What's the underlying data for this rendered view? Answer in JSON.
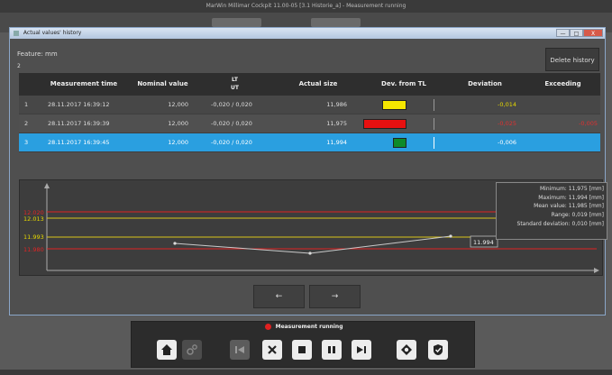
{
  "window": {
    "title": "MarWin Millimar Cockpit 11.00-05   [3.1 Historie_a]   -   Measurement running"
  },
  "dialog": {
    "title": "Actual values' history",
    "controls": {
      "minimize": "—",
      "maximize": "□",
      "close": "X"
    }
  },
  "feature": {
    "label": "Feature: mm",
    "count": "2"
  },
  "delete_button": "Delete history",
  "table": {
    "headers": {
      "index": "",
      "time": "Measurement time",
      "nominal": "Nominal value",
      "lt": "LT",
      "ut": "UT",
      "actual": "Actual size",
      "devtl": "Dev. from TL",
      "deviation": "Deviation",
      "exceeding": "Exceeding"
    },
    "rows": [
      {
        "index": "1",
        "time": "28.11.2017 16:39:12",
        "nominal": "12,000",
        "tol": "-0,020 / 0,020",
        "actual": "11,986",
        "bar_color": "#f5e600",
        "bar_fraction": 0.35,
        "deviation": "-0,014",
        "deviation_color": "#e6d800",
        "exceeding": "",
        "exceeding_color": "#e03030"
      },
      {
        "index": "2",
        "time": "28.11.2017 16:39:39",
        "nominal": "12,000",
        "tol": "-0,020 / 0,020",
        "actual": "11,975",
        "bar_color": "#e81010",
        "bar_fraction": 0.62,
        "deviation": "-0,025",
        "deviation_color": "#e03030",
        "exceeding": "-0,005",
        "exceeding_color": "#e03030"
      },
      {
        "index": "3",
        "time": "28.11.2017 16:39:45",
        "nominal": "12,000",
        "tol": "-0,020 / 0,020",
        "actual": "11,994",
        "bar_color": "#0e8a2a",
        "bar_fraction": 0.19,
        "deviation": "-0,006",
        "deviation_color": "#ffffff",
        "exceeding": "",
        "exceeding_color": "#e03030"
      }
    ],
    "selected_row": 2
  },
  "chart_data": {
    "type": "line",
    "y_labels": {
      "upper_red": "12.020",
      "upper_yellow": "12.013",
      "lower_yellow": "11.993",
      "lower_red": "11.980"
    },
    "values": [
      11.986,
      11.975,
      11.994
    ],
    "last_value_label": "11.994",
    "colors": {
      "red": "#e02424",
      "yellow": "#d9c51a",
      "line": "#c9c9c9"
    }
  },
  "stats": {
    "minimum": "Minimum: 11,975 [mm]",
    "maximum": "Maximum: 11,994 [mm]",
    "mean": "Mean value: 11,985 [mm]",
    "range": "Range: 0,019 [mm]",
    "std": "Standard deviation: 0,010 [mm]"
  },
  "nav": {
    "prev": "←",
    "next": "→"
  },
  "toolbar": {
    "status": "Measurement running",
    "status_color": "#e02020",
    "buttons": [
      "home-icon",
      "gears-icon",
      "skip-back-icon",
      "cancel-icon",
      "stop-icon",
      "pause-icon",
      "skip-forward-icon",
      "record-icon",
      "check-icon"
    ]
  }
}
